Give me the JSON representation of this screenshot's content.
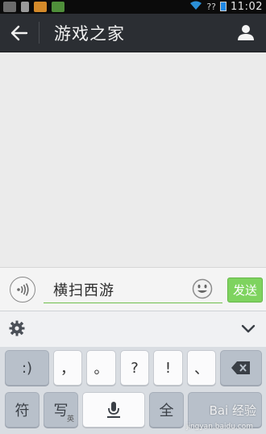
{
  "status_bar": {
    "time": "11:02",
    "signal_text": "??",
    "icons": [
      "usb-icon",
      "notification-icon",
      "app-icon",
      "wifi-icon",
      "battery-icon"
    ]
  },
  "header": {
    "title": "游戏之家",
    "back_icon": "back-arrow-icon",
    "profile_icon": "profile-icon"
  },
  "composer": {
    "input_value": "横扫西游",
    "send_label": "发送",
    "voice_icon": "voice-icon",
    "emoji_icon": "emoji-icon",
    "accent_color": "#7ed35f"
  },
  "keyboard": {
    "row1": [
      ":)",
      "，",
      "。",
      "?",
      "!",
      "、"
    ],
    "row2": {
      "symbols": "符",
      "handwrite": "写",
      "handwrite_sub": "英",
      "space_icon": "mic-icon",
      "fullwidth": "全"
    },
    "watermark": "Bai 经验",
    "watermark_url": "jingyan.baidu.com"
  }
}
